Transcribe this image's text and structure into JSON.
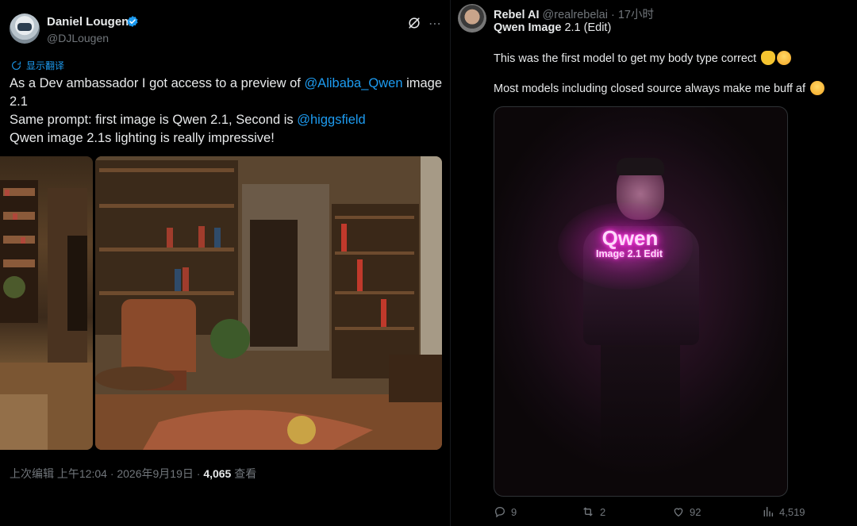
{
  "left_tweet": {
    "author_name": "Daniel Lougen",
    "author_handle": "@DJLougen",
    "translate_label": "显示翻译",
    "text_line1_a": "As a Dev ambassador I got access to a preview of ",
    "text_line1_mention": "@Alibaba_Qwen",
    "text_line1_b": " image",
    "text_line2": "2.1",
    "text_line3_a": "Same prompt: first image is Qwen 2.1, Second is ",
    "text_line3_mention": "@higgsfield",
    "text_line4": "Qwen image 2.1s lighting is really impressive!",
    "footer_prefix": "上次编辑 上午12:04 · 2026年9月19日 · ",
    "views_count": "4,065",
    "views_label": " 查看",
    "icons": [
      "verified-badge-icon",
      "grok-icon",
      "more-icon",
      "translate-icon"
    ]
  },
  "right_tweet": {
    "author_name": "Rebel AI",
    "author_meta": "@realrebelai · 17小时",
    "quote_title_bold": "Qwen Image",
    "quote_title_rest": " 2.1 (Edit)",
    "body_line1": "This was the first model to get my body type correct",
    "body_line2": "Most models including closed source always make me buff af",
    "photo_neon_title": "Qwen",
    "photo_neon_sub": "Image 2.1 Edit",
    "replies": "9",
    "reposts": "2",
    "likes": "92",
    "views": "4,519",
    "icons": [
      "reply-icon",
      "repost-icon",
      "like-icon",
      "views-icon"
    ]
  },
  "colors": {
    "background": "#000000",
    "text": "#e7e9ea",
    "muted": "#71767b",
    "link": "#1d9bf0",
    "neon": "#ff2fd8"
  }
}
